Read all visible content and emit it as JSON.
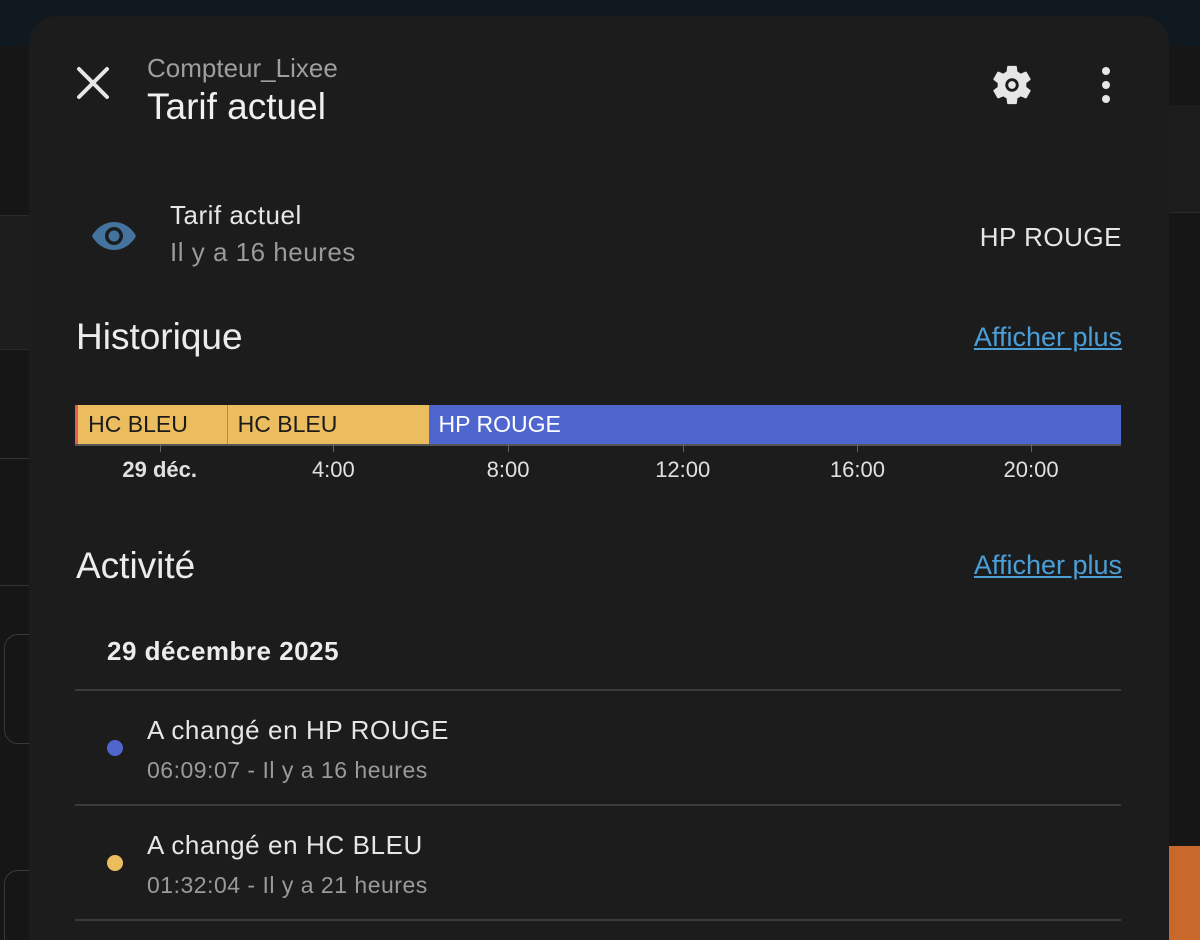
{
  "dialog": {
    "subtitle": "Compteur_Lixee",
    "title": "Tarif actuel",
    "icons": {
      "close": "close-icon",
      "settings": "gear-icon",
      "more": "more-vertical-icon"
    }
  },
  "entity": {
    "icon": "eye-icon",
    "name": "Tarif actuel",
    "last_changed": "Il y a 16 heures",
    "state": "HP ROUGE"
  },
  "history": {
    "heading": "Historique",
    "show_more": "Afficher plus",
    "segments": [
      {
        "label": "",
        "fraction": 0.003,
        "color": "#e35d52"
      },
      {
        "label": "HC BLEU",
        "fraction": 0.142,
        "color": "#ecbd5e"
      },
      {
        "label": "HC BLEU",
        "fraction": 0.193,
        "color": "#ecbd5e"
      },
      {
        "label": "HP ROUGE",
        "fraction": 0.662,
        "color": "#4f66ce"
      }
    ],
    "axis": [
      {
        "label": "29 déc.",
        "pos": 0.081,
        "bold": true
      },
      {
        "label": "4:00",
        "pos": 0.247,
        "bold": false
      },
      {
        "label": "8:00",
        "pos": 0.414,
        "bold": false
      },
      {
        "label": "12:00",
        "pos": 0.581,
        "bold": false
      },
      {
        "label": "16:00",
        "pos": 0.748,
        "bold": false
      },
      {
        "label": "20:00",
        "pos": 0.914,
        "bold": false
      }
    ]
  },
  "activity": {
    "heading": "Activité",
    "show_more": "Afficher plus",
    "date": "29 décembre 2025",
    "entries": [
      {
        "title": "A changé en HP ROUGE",
        "subtitle": "06:09:07 - Il y a 16 heures",
        "color": "#4f66ce"
      },
      {
        "title": "A changé en HC BLEU",
        "subtitle": "01:32:04 - Il y a 21 heures",
        "color": "#ecbd5e"
      }
    ]
  },
  "colors": {
    "accent": "#4a9fd8",
    "hc_bleu": "#ecbd5e",
    "hp_rouge": "#4f66ce",
    "eye_icon": "#44739e"
  }
}
